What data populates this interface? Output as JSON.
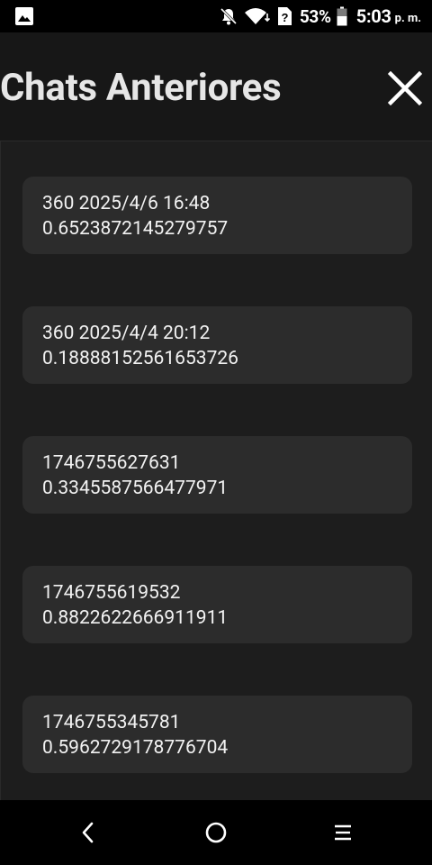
{
  "status_bar": {
    "battery_percent": "53%",
    "time": "5:03",
    "ampm": "p. m.",
    "icons": [
      "image-icon",
      "notifications-off-icon",
      "wifi-icon",
      "no-sim-icon",
      "battery-icon"
    ]
  },
  "header": {
    "title": "Chats Anteriores",
    "close_icon": "close-icon"
  },
  "chats": [
    {
      "title": "360 2025/4/6 16:48",
      "subtitle": "0.6523872145279757"
    },
    {
      "title": "360 2025/4/4 20:12",
      "subtitle": "0.18888152561653726"
    },
    {
      "title": "1746755627631",
      "subtitle": "0.3345587566477971"
    },
    {
      "title": "1746755619532",
      "subtitle": "0.8822622666911911"
    },
    {
      "title": "1746755345781",
      "subtitle": "0.5962729178776704"
    }
  ],
  "nav_bar": {
    "icons": [
      "back-icon",
      "home-icon",
      "recents-icon"
    ]
  },
  "colors": {
    "header_bg": "#171717",
    "list_bg": "#1d1d1d",
    "card_bg": "#2c2c2c",
    "text": "#f2f2f2"
  }
}
